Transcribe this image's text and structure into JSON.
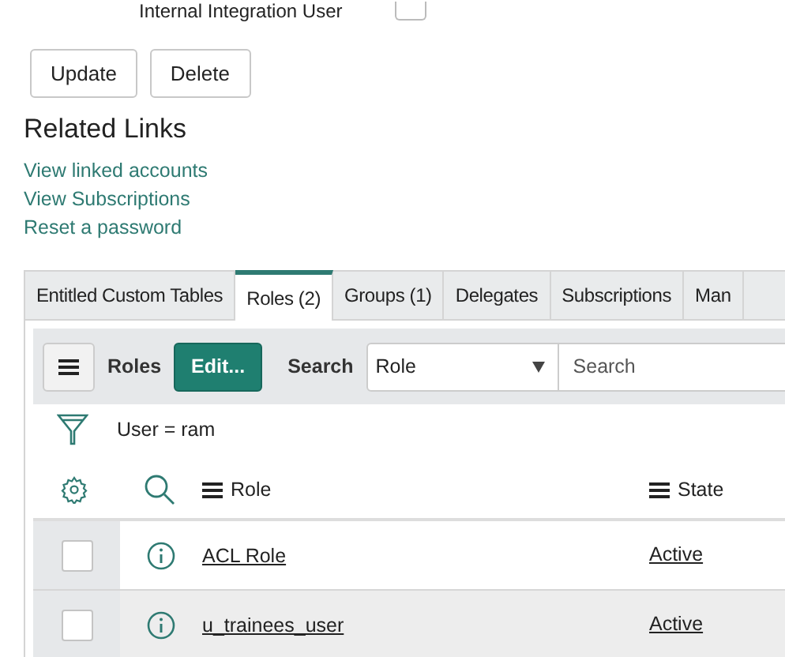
{
  "top_field": {
    "label": "Internal Integration User",
    "checked": false
  },
  "buttons": [
    "Update",
    "Delete"
  ],
  "related_links": {
    "title": "Related Links",
    "links": [
      "View linked accounts",
      "View Subscriptions",
      "Reset a password"
    ]
  },
  "tabs": [
    {
      "label": "Entitled Custom Tables",
      "selected": false
    },
    {
      "label": "Roles (2)",
      "selected": true
    },
    {
      "label": "Groups (1)",
      "selected": false
    },
    {
      "label": "Delegates",
      "selected": false
    },
    {
      "label": "Subscriptions",
      "selected": false
    },
    {
      "label": "Man",
      "selected": false
    }
  ],
  "toolbar": {
    "list_title": "Roles",
    "edit_button": "Edit...",
    "search_label": "Search",
    "search_field": "Role",
    "search_placeholder": "Search"
  },
  "filter": "User = ram",
  "table": {
    "columns": [
      "Role",
      "State"
    ],
    "rows": [
      {
        "checked": false,
        "cells": [
          "ACL Role",
          "Active"
        ]
      },
      {
        "checked": false,
        "cells": [
          "u_trainees_user",
          "Active"
        ]
      }
    ]
  }
}
